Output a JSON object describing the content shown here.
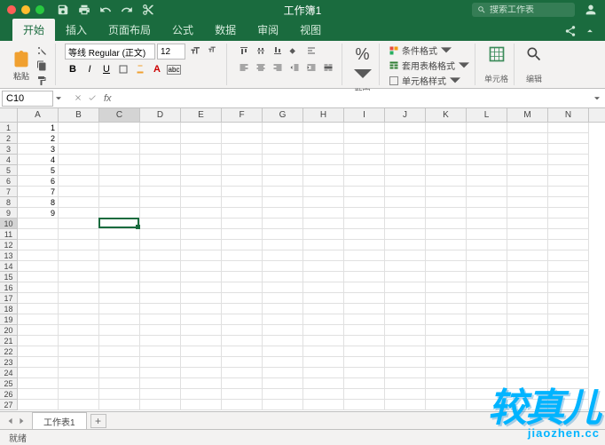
{
  "titlebar": {
    "doc_title": "工作簿1"
  },
  "search": {
    "placeholder": "搜索工作表"
  },
  "tabs": [
    "开始",
    "插入",
    "页面布局",
    "公式",
    "数据",
    "审阅",
    "视图"
  ],
  "active_tab": 0,
  "ribbon": {
    "paste": "粘贴",
    "font_name": "等线 Regular (正文)",
    "font_size": "12",
    "number_group": "数字",
    "cf": "条件格式",
    "fmt_table": "套用表格格式",
    "cell_style": "单元格样式",
    "cells_group": "单元格",
    "edit_group": "编辑"
  },
  "formula": {
    "namebox": "C10"
  },
  "grid": {
    "cols": [
      "A",
      "B",
      "C",
      "D",
      "E",
      "F",
      "G",
      "H",
      "I",
      "J",
      "K",
      "L",
      "M",
      "N"
    ],
    "rows": 27,
    "active_cell": {
      "row": 10,
      "col": 3
    },
    "data": {
      "A1": "1",
      "A2": "2",
      "A3": "3",
      "A4": "4",
      "A5": "5",
      "A6": "6",
      "A7": "7",
      "A8": "8",
      "A9": "9"
    }
  },
  "sheet": {
    "name": "工作表1",
    "add": "+"
  },
  "status": {
    "ready": "就绪"
  },
  "watermark": {
    "text": "较真儿",
    "url": "jiaozhen.cc"
  }
}
